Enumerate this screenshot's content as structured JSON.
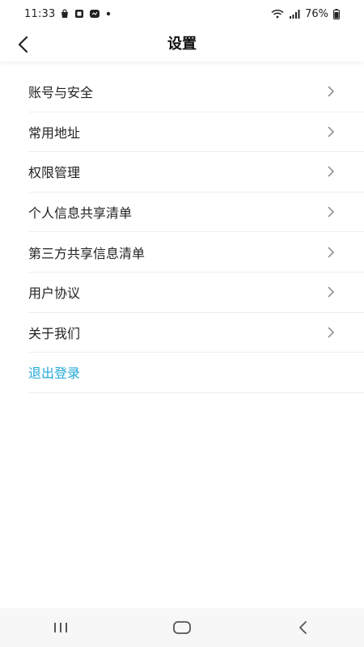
{
  "status_bar": {
    "time": "11:33",
    "battery": "76%",
    "left_icons": [
      "shopping-bag-icon",
      "media-icon",
      "message-icon",
      "dot-icon"
    ],
    "right_icons": [
      "wifi-icon",
      "signal-icon",
      "battery-icon"
    ]
  },
  "header": {
    "title": "设置",
    "back_icon": "back-arrow-icon"
  },
  "menu": {
    "items": [
      {
        "label": "账号与安全"
      },
      {
        "label": "常用地址"
      },
      {
        "label": "权限管理"
      },
      {
        "label": "个人信息共享清单"
      },
      {
        "label": "第三方共享信息清单"
      },
      {
        "label": "用户协议"
      },
      {
        "label": "关于我们"
      }
    ],
    "logout_label": "退出登录",
    "logout_color": "#21a8d8"
  },
  "nav_bar": {
    "buttons": [
      "recent-apps-icon",
      "home-icon",
      "back-icon"
    ]
  }
}
